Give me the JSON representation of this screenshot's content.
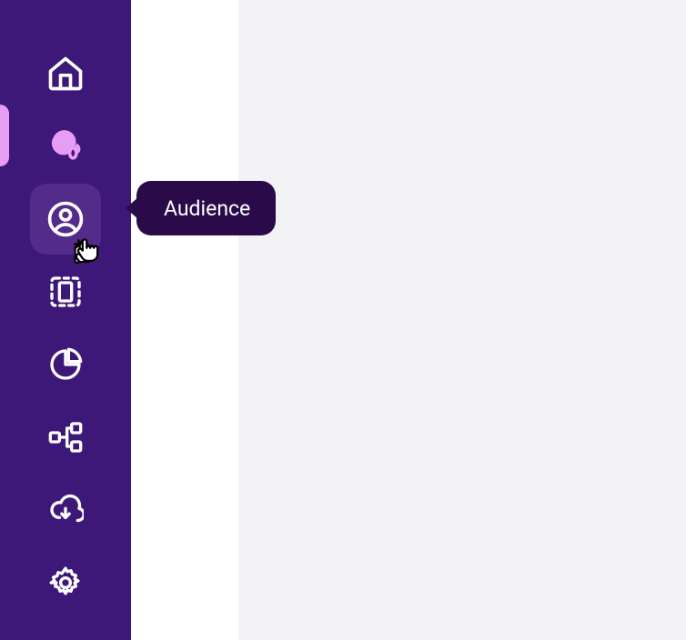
{
  "sidebar": {
    "background": "#3d1878",
    "active_accent": "#e89df5",
    "items": [
      {
        "name": "home",
        "icon": "home-icon"
      },
      {
        "name": "campaigns",
        "icon": "megaphone-icon",
        "active": true
      },
      {
        "name": "audience",
        "icon": "user-circle-icon",
        "hovered": true
      },
      {
        "name": "templates",
        "icon": "template-icon"
      },
      {
        "name": "analytics",
        "icon": "pie-chart-icon"
      },
      {
        "name": "integrations",
        "icon": "org-chart-icon"
      },
      {
        "name": "downloads",
        "icon": "cloud-download-icon"
      },
      {
        "name": "settings",
        "icon": "gear-icon"
      }
    ]
  },
  "tooltip": {
    "label": "Audience",
    "background": "#2b0a4a"
  }
}
